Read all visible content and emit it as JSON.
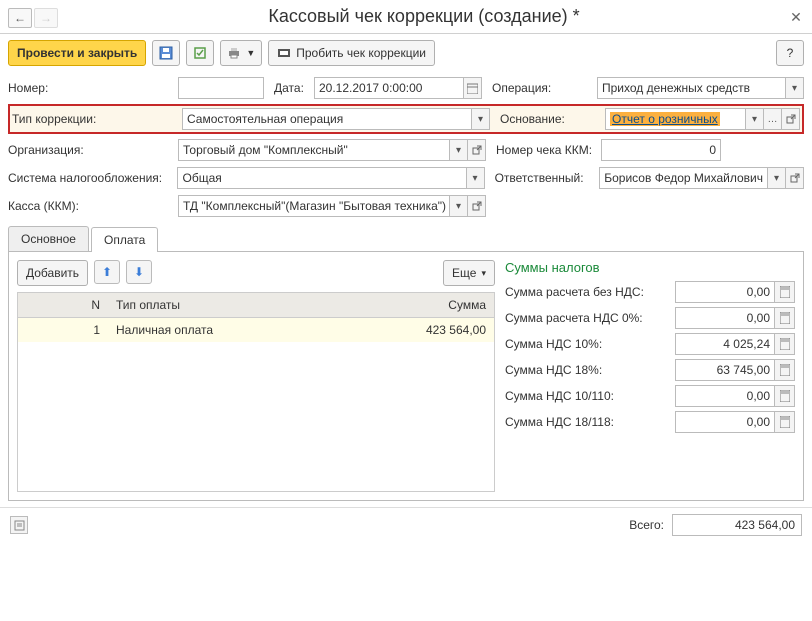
{
  "title": "Кассовый чек коррекции (создание) *",
  "toolbar": {
    "main_action": "Провести и закрыть",
    "correction_btn": "Пробить чек коррекции",
    "help": "?"
  },
  "fields": {
    "number_label": "Номер:",
    "number_value": "",
    "date_label": "Дата:",
    "date_value": "20.12.2017 0:00:00",
    "operation_label": "Операция:",
    "operation_value": "Приход денежных средств",
    "corr_type_label": "Тип коррекции:",
    "corr_type_value": "Самостоятельная операция",
    "basis_label": "Основание:",
    "basis_value": "Отчет о розничных",
    "org_label": "Организация:",
    "org_value": "Торговый дом \"Комплексный\"",
    "kkm_num_label": "Номер чека ККМ:",
    "kkm_num_value": "0",
    "tax_system_label": "Система налогообложения:",
    "tax_system_value": "Общая",
    "responsible_label": "Ответственный:",
    "responsible_value": "Борисов Федор Михайлович",
    "kassa_label": "Касса (ККМ):",
    "kassa_value": "ТД \"Комплексный\"(Магазин \"Бытовая техника\")"
  },
  "tabs": {
    "main": "Основное",
    "payment": "Оплата"
  },
  "payment": {
    "add_btn": "Добавить",
    "more_btn": "Еще",
    "columns": {
      "n": "N",
      "type": "Тип оплаты",
      "sum": "Сумма"
    },
    "rows": [
      {
        "n": "1",
        "type": "Наличная оплата",
        "sum": "423 564,00"
      }
    ]
  },
  "taxes": {
    "header": "Суммы налогов",
    "items": [
      {
        "label": "Сумма расчета без НДС:",
        "value": "0,00"
      },
      {
        "label": "Сумма расчета НДС 0%:",
        "value": "0,00"
      },
      {
        "label": "Сумма НДС 10%:",
        "value": "4 025,24"
      },
      {
        "label": "Сумма НДС 18%:",
        "value": "63 745,00"
      },
      {
        "label": "Сумма НДС 10/110:",
        "value": "0,00"
      },
      {
        "label": "Сумма НДС 18/118:",
        "value": "0,00"
      }
    ]
  },
  "footer": {
    "total_label": "Всего:",
    "total_value": "423 564,00"
  }
}
